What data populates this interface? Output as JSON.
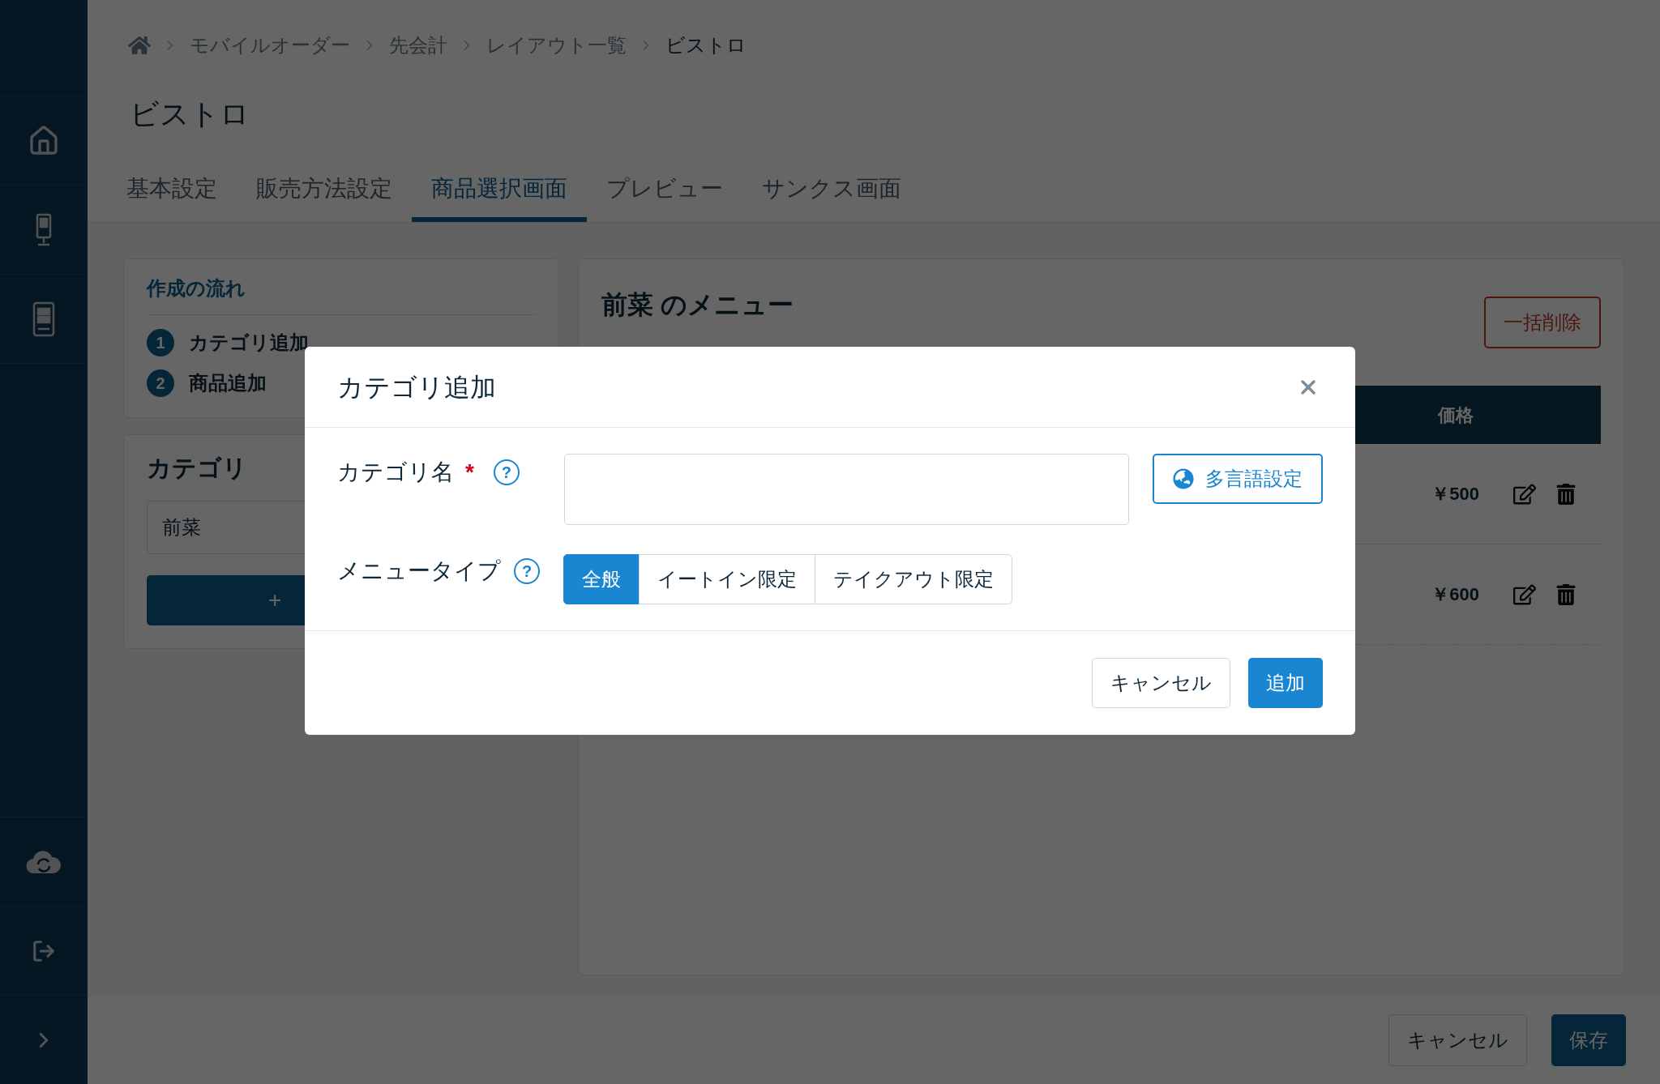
{
  "sidebar": {
    "items": [
      {
        "kind": "home"
      },
      {
        "kind": "kiosk"
      },
      {
        "kind": "tablet"
      },
      {
        "kind": "sync"
      },
      {
        "kind": "logout"
      },
      {
        "kind": "expand"
      }
    ]
  },
  "breadcrumb": [
    "モバイルオーダー",
    "先会計",
    "レイアウト一覧",
    "ビストロ"
  ],
  "page_title": "ビストロ",
  "tabs": [
    {
      "label": "基本設定",
      "selected": false
    },
    {
      "label": "販売方法設定",
      "selected": false
    },
    {
      "label": "商品選択画面",
      "selected": true
    },
    {
      "label": "プレビュー",
      "selected": false
    },
    {
      "label": "サンクス画面",
      "selected": false
    }
  ],
  "flow": {
    "title": "作成の流れ",
    "steps": [
      {
        "number": "1",
        "label": "カテゴリ追加"
      },
      {
        "number": "2",
        "label": "商品追加"
      }
    ]
  },
  "categories": {
    "title": "カテゴリ",
    "items": [
      "前菜"
    ],
    "add_button": "+"
  },
  "menu": {
    "title": "前菜 のメニュー",
    "bulk_delete": "一括削除",
    "columns": [
      "価格"
    ],
    "rows": [
      {
        "price": "￥500"
      },
      {
        "price": "￥600"
      }
    ]
  },
  "footer": {
    "cancel": "キャンセル",
    "save": "保存"
  },
  "dialog": {
    "title": "カテゴリ追加",
    "name_label": "カテゴリ名",
    "required_mark": "*",
    "help_mark": "?",
    "multilang_button": "多言語設定",
    "type_label": "メニュータイプ",
    "type_options": [
      {
        "label": "全般",
        "selected": true
      },
      {
        "label": "イートイン限定",
        "selected": false
      },
      {
        "label": "テイクアウト限定",
        "selected": false
      }
    ],
    "cancel": "キャンセル",
    "submit": "追加"
  }
}
